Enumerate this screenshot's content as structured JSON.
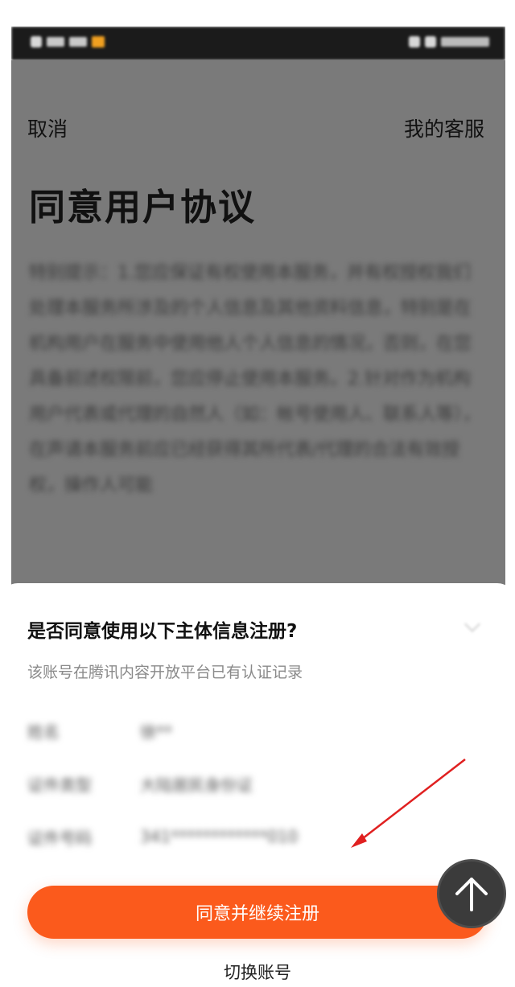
{
  "header": {
    "cancel_label": "取消",
    "service_label": "我的客服",
    "title": "同意用户协议"
  },
  "agreement_text": "特别提示：1.您应保证有权使用本服务，并有权授权我们处理本服务所涉及的个人信息及其他资料信息，特别是在机构用户在服务中使用他人个人信息的情况，否则，在您具备前述权限前，您应停止使用本服务。2.针对作为机构用户代表或代理的自然人（如：帐号使用人、联系人等），在声请本服务前应已经获得其所代表/代理的合法有效授权，操作人可能",
  "sheet": {
    "title": "是否同意使用以下主体信息注册?",
    "subtitle": "该账号在腾讯内容开放平台已有认证记录",
    "rows": [
      {
        "label": "姓名",
        "value": "徐**"
      },
      {
        "label": "证件类型",
        "value": "大陆居民身份证"
      },
      {
        "label": "证件号码",
        "value": "341************010"
      }
    ],
    "agree_button": "同意并继续注册",
    "switch_account": "切换账号"
  },
  "colors": {
    "accent": "#fb5a1c",
    "overlay": "#7a7a7a",
    "annotation": "#e02020"
  },
  "icons": {
    "collapse": "chevron-down-icon",
    "scroll_top": "arrow-up-icon"
  }
}
